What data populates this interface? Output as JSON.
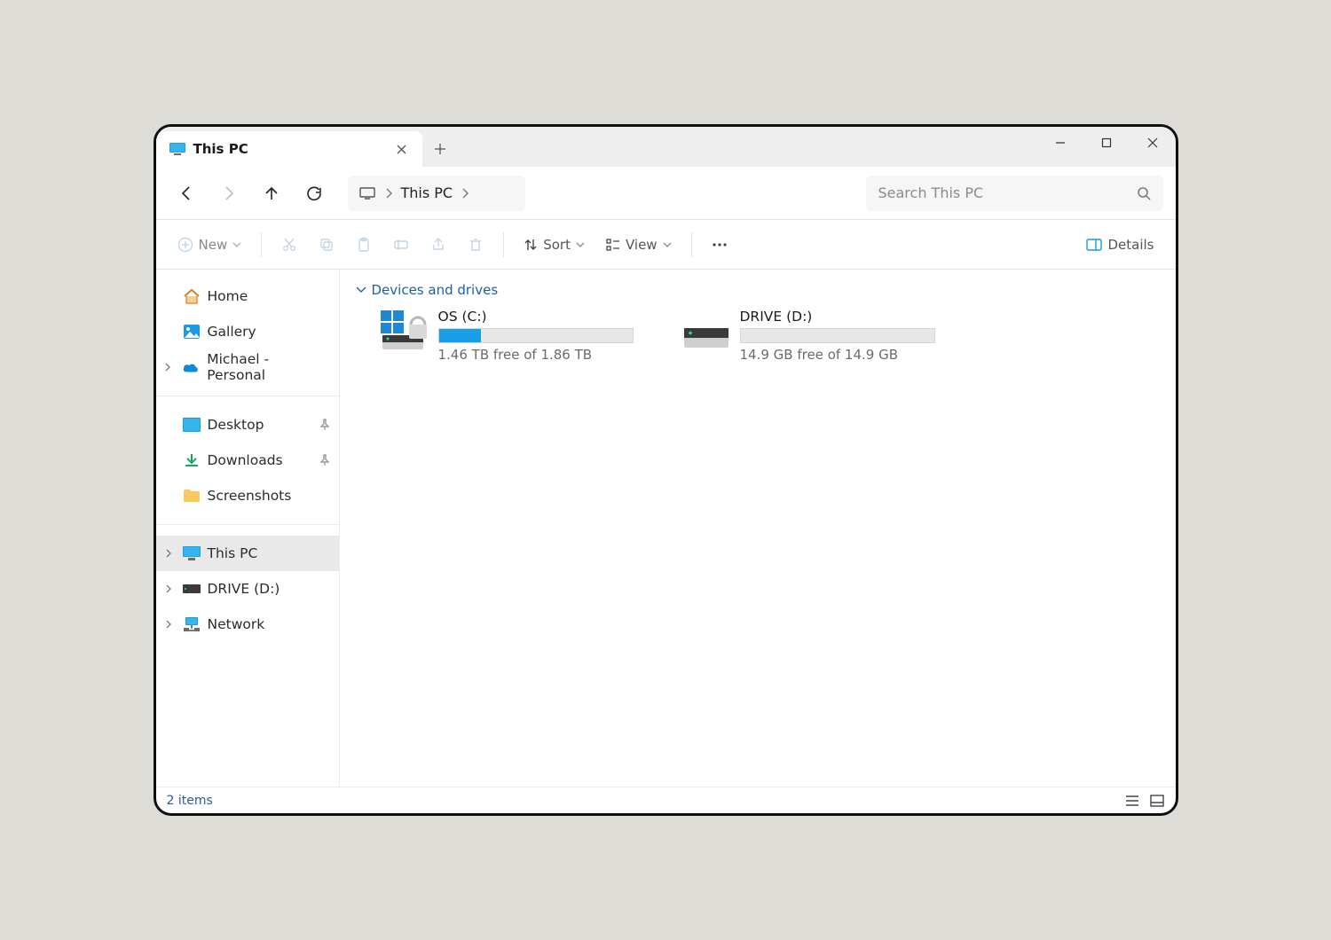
{
  "tab": {
    "title": "This PC"
  },
  "breadcrumb": {
    "location": "This PC"
  },
  "search": {
    "placeholder": "Search This PC"
  },
  "toolbar": {
    "new_label": "New",
    "sort_label": "Sort",
    "view_label": "View",
    "details_label": "Details"
  },
  "sidebar": {
    "group1": [
      {
        "label": "Home",
        "icon": "home"
      },
      {
        "label": "Gallery",
        "icon": "gallery"
      },
      {
        "label": "Michael - Personal",
        "icon": "onedrive",
        "expandable": true
      }
    ],
    "group2": [
      {
        "label": "Desktop",
        "icon": "desktop",
        "pinned": true
      },
      {
        "label": "Downloads",
        "icon": "downloads",
        "pinned": true
      },
      {
        "label": "Screenshots",
        "icon": "folder"
      }
    ],
    "group3": [
      {
        "label": "This PC",
        "icon": "thispc",
        "expandable": true,
        "selected": true
      },
      {
        "label": "DRIVE (D:)",
        "icon": "drive-small",
        "expandable": true
      },
      {
        "label": "Network",
        "icon": "network",
        "expandable": true
      }
    ]
  },
  "section": {
    "title": "Devices and drives"
  },
  "drives": [
    {
      "name": "OS (C:)",
      "free_text": "1.46 TB free of 1.86 TB",
      "fill_pct": 22,
      "kind": "os"
    },
    {
      "name": "DRIVE (D:)",
      "free_text": "14.9 GB free of 14.9 GB",
      "fill_pct": 0,
      "kind": "hdd"
    }
  ],
  "status": {
    "text": "2 items"
  }
}
